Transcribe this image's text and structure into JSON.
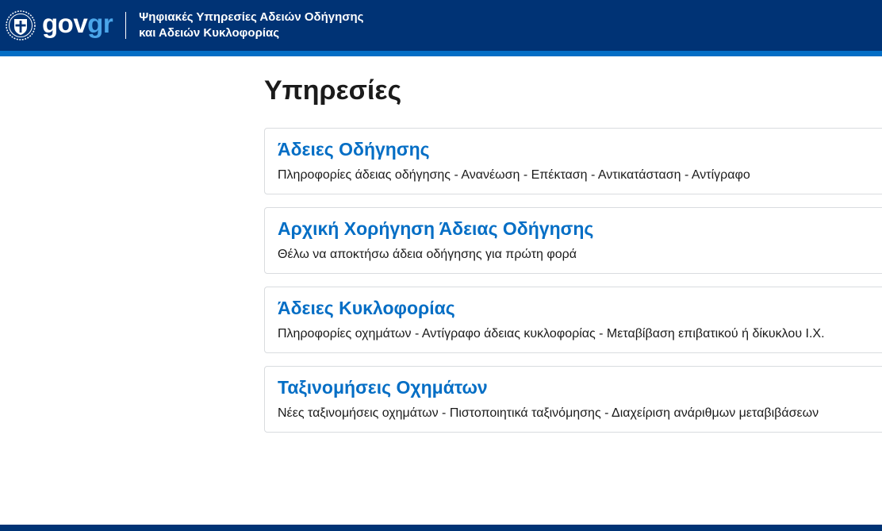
{
  "header": {
    "logo": {
      "gov": "gov",
      "gr": "gr",
      "emblem_icon": "greek-coat-of-arms-icon"
    },
    "service_title_line1": "Ψηφιακές Υπηρεσίες Αδειών Οδήγησης",
    "service_title_line2": "και Αδειών Κυκλοφορίας"
  },
  "main": {
    "page_title": "Υπηρεσίες",
    "cards": [
      {
        "title": "Άδειες Οδήγησης",
        "description": "Πληροφορίες άδειας οδήγησης - Ανανέωση - Επέκταση - Αντικατάσταση - Αντίγραφο"
      },
      {
        "title": "Αρχική Χορήγηση Άδειας Οδήγησης",
        "description": "Θέλω να αποκτήσω άδεια οδήγησης για πρώτη φορά"
      },
      {
        "title": "Άδειες Κυκλοφορίας",
        "description": "Πληροφορίες οχημάτων - Αντίγραφο άδειας κυκλοφορίας - Μεταβίβαση επιβατικού ή δίκυκλου Ι.Χ."
      },
      {
        "title": "Ταξινομήσεις Οχημάτων",
        "description": "Νέες ταξινομήσεις οχημάτων - Πιστοποιητικά ταξινόμησης - Διαχείριση ανάριθμων μεταβιβάσεων"
      }
    ]
  },
  "colors": {
    "header_bg": "#003375",
    "header_stripe": "#046ec5",
    "link": "#046ec5",
    "logo_accent": "#4ba6ea"
  }
}
